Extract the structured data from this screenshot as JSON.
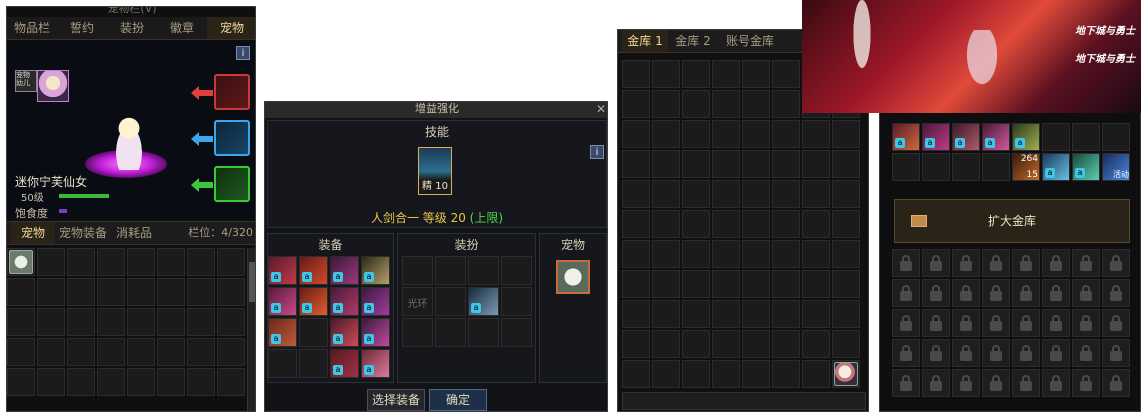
{
  "pet_window": {
    "title": "宠物栏(V)",
    "tabs": [
      "物品栏",
      "誓约",
      "装扮",
      "徽章",
      "宠物"
    ],
    "active_tab_index": 4,
    "info_label": "i",
    "pet_name": "迷你宁芙仙女",
    "level": "50级",
    "satiety_label": "饱食度",
    "thumb_label": "宠物\n幼儿",
    "sub_tabs": [
      "宠物",
      "宠物装备",
      "消耗品"
    ],
    "slots_label": "栏位：4/320",
    "colors": {
      "level_bar": "#3cb83c",
      "satiety_bar": "#7a3cc8",
      "active_tab": "#f2d59a"
    }
  },
  "enhance_window": {
    "title": "增益强化",
    "skill_header": "技能",
    "info_label": "i",
    "skill_badge": "精 10",
    "skill_line": "人剑合一 等级 20",
    "skill_limit": "(上限)",
    "columns": [
      "装备",
      "装扮",
      "宠物"
    ],
    "avatar_slot_label": "光环",
    "buttons": {
      "select": "选择装备",
      "confirm": "确定"
    },
    "colors": {
      "skill_line": "#e8c64a",
      "limit": "#4cd84c"
    }
  },
  "vault_window": {
    "tabs": [
      "金库 1",
      "金库 2",
      "账号金库"
    ],
    "active_tab_index": 0
  },
  "account_vault": {
    "banner_logo_top": "地下城与勇士",
    "banner_logo_bottom": "地下城与勇士",
    "item_counts": [
      "264",
      "15"
    ],
    "item_tag": "活动",
    "expand_label": "扩大金库"
  }
}
